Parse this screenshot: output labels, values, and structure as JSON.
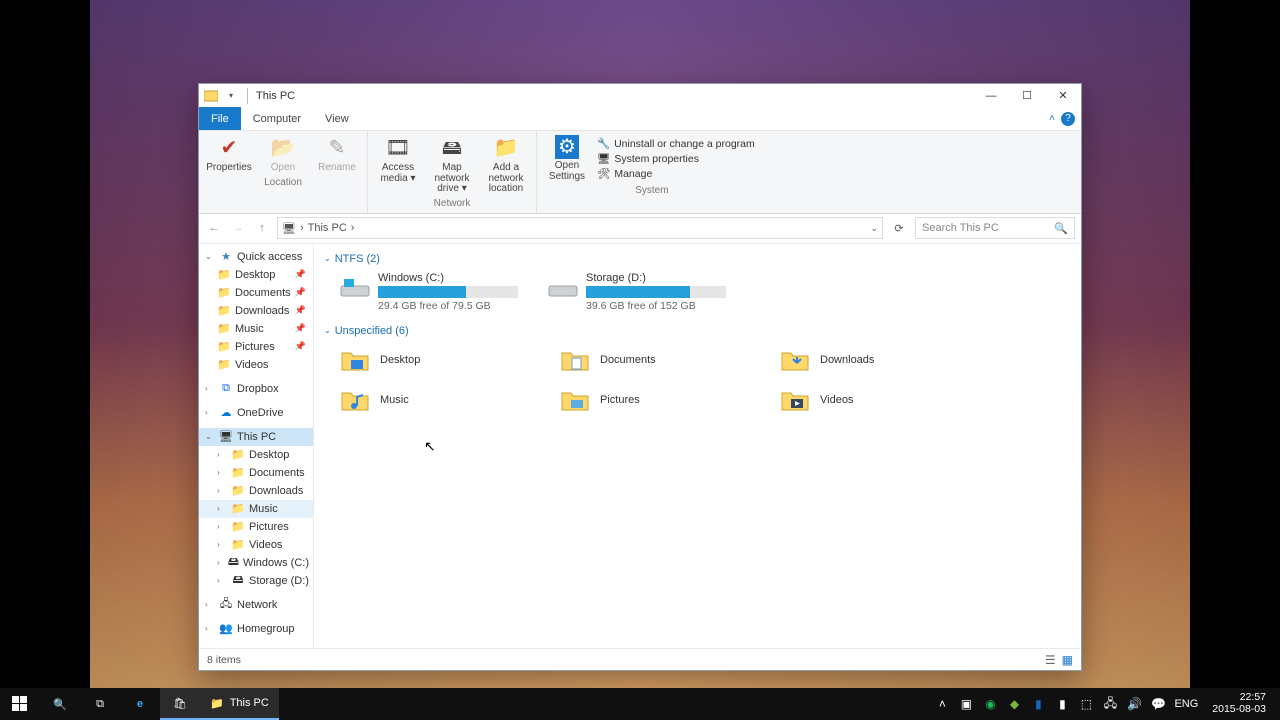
{
  "window": {
    "title": "This PC",
    "tabs": {
      "file": "File",
      "computer": "Computer",
      "view": "View"
    },
    "controls": {
      "minimize": "—",
      "maximize": "☐",
      "close": "✕"
    }
  },
  "ribbon": {
    "location": {
      "label": "Location",
      "properties": "Properties",
      "open": "Open",
      "rename": "Rename"
    },
    "network": {
      "label": "Network",
      "access_media": "Access media ▾",
      "map_drive": "Map network drive ▾",
      "add_location": "Add a network location"
    },
    "settings": {
      "open_settings": "Open Settings"
    },
    "system": {
      "label": "System",
      "uninstall": "Uninstall or change a program",
      "properties": "System properties",
      "manage": "Manage"
    }
  },
  "nav": {
    "breadcrumb": "This PC",
    "crumb_sep": "›",
    "search_placeholder": "Search This PC"
  },
  "sidebar": {
    "quick_access": "Quick access",
    "qa_items": [
      "Desktop",
      "Documents",
      "Downloads",
      "Music",
      "Pictures",
      "Videos"
    ],
    "dropbox": "Dropbox",
    "onedrive": "OneDrive",
    "this_pc": "This PC",
    "pc_items": [
      "Desktop",
      "Documents",
      "Downloads",
      "Music",
      "Pictures",
      "Videos",
      "Windows (C:)",
      "Storage (D:)"
    ],
    "network": "Network",
    "homegroup": "Homegroup"
  },
  "content": {
    "group_ntfs": "NTFS (2)",
    "group_unspecified": "Unspecified (6)",
    "drives": [
      {
        "name": "Windows (C:)",
        "free": "29.4 GB free of 79.5 GB",
        "pct": 63
      },
      {
        "name": "Storage (D:)",
        "free": "39.6 GB free of 152 GB",
        "pct": 74
      }
    ],
    "folders": [
      "Desktop",
      "Documents",
      "Downloads",
      "Music",
      "Pictures",
      "Videos"
    ]
  },
  "status": {
    "items": "8 items"
  },
  "taskbar": {
    "running_label": "This PC",
    "lang": "ENG",
    "time": "22:57",
    "date": "2015-08-03"
  }
}
